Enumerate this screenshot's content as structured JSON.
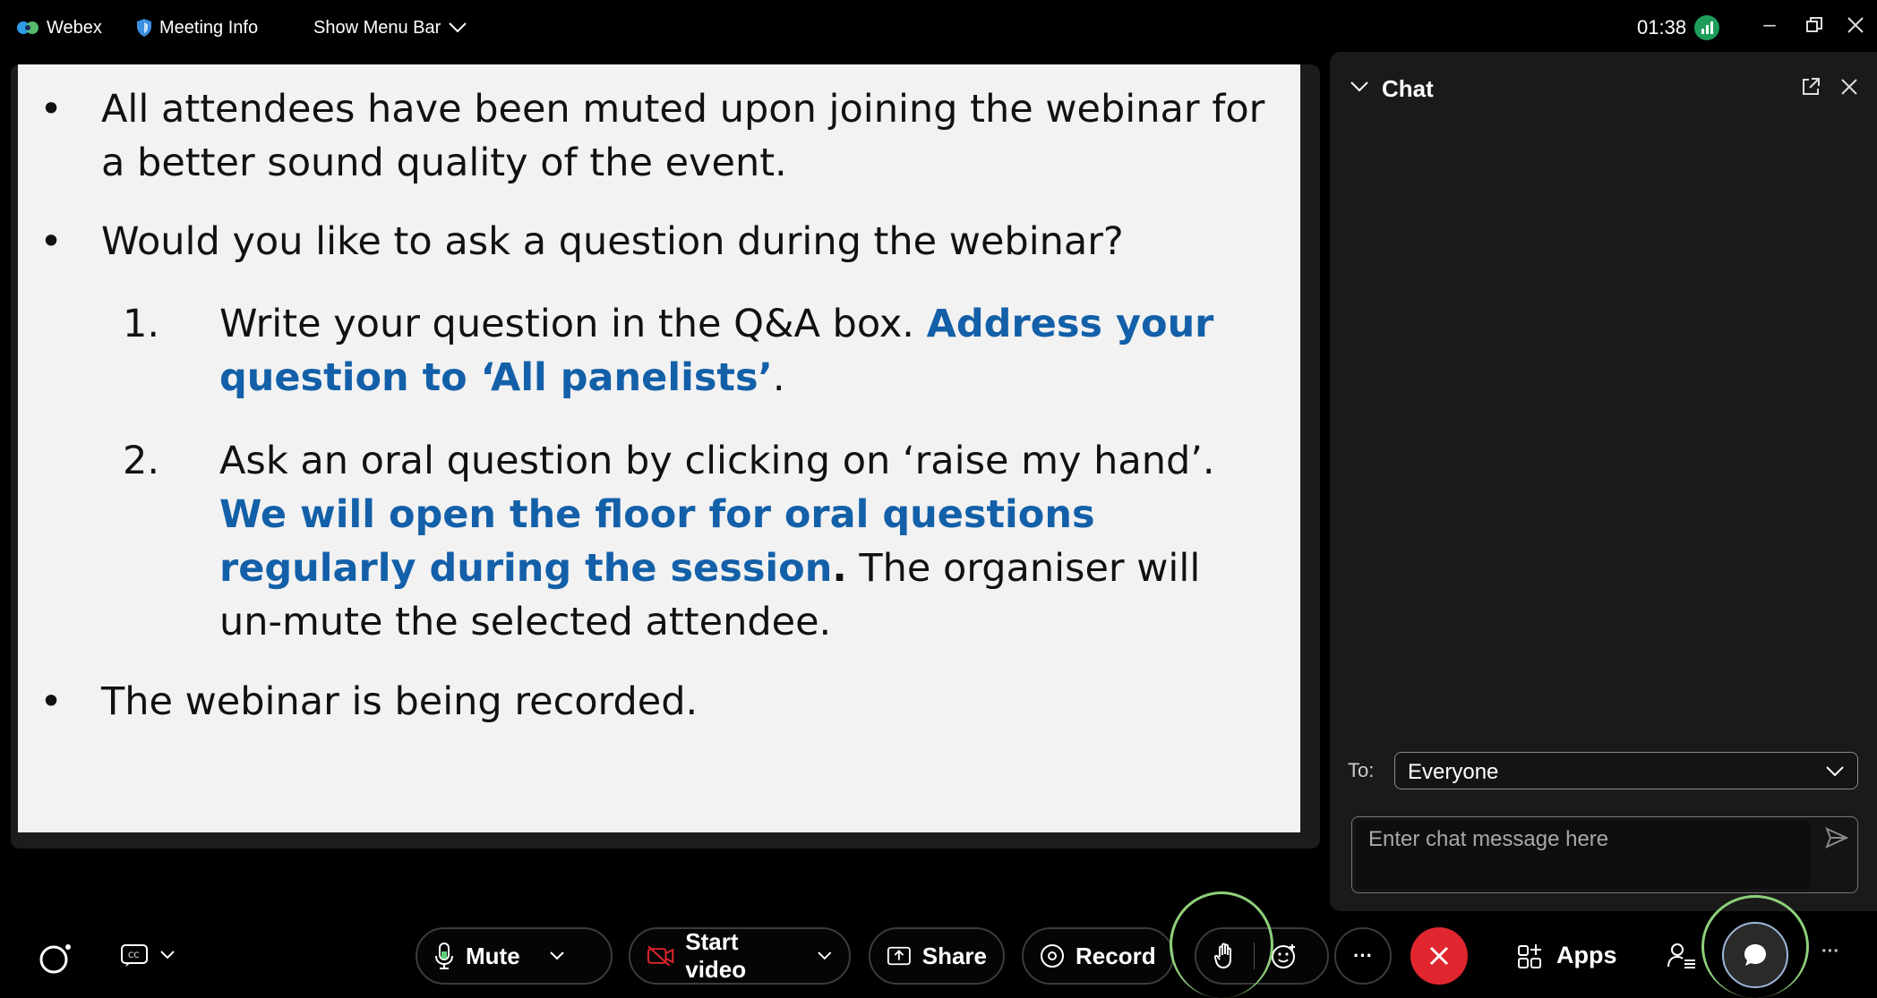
{
  "topbar": {
    "app_name": "Webex",
    "meeting_info": "Meeting Info",
    "show_menu_bar": "Show Menu Bar",
    "time": "01:38"
  },
  "slide": {
    "bullet1": "All attendees have been muted upon joining the webinar for a better sound quality of the event.",
    "bullet2": "Would you like to ask a question during the webinar?",
    "item1_num": "1.",
    "item1_text": "Write your question in the Q&A box.",
    "item1_bold": "Address your question to ‘All panelists’",
    "item1_end": ".",
    "item2_num": "2.",
    "item2_text": "Ask an oral question by clicking on ‘raise my hand’.",
    "item2_bold": "We will open the floor for oral questions regularly during the session",
    "item2_dot": ".",
    "item2_rest": "The organiser will un-mute the selected attendee.",
    "bullet3": "The webinar is being recorded."
  },
  "chat": {
    "title": "Chat",
    "to_label": "To:",
    "to_value": "Everyone",
    "message_placeholder": "Enter chat message here"
  },
  "controls": {
    "mute": "Mute",
    "start_video": "Start video",
    "share": "Share",
    "record": "Record",
    "apps": "Apps",
    "more": "···"
  },
  "colors": {
    "accent_blue": "#1360a9",
    "end_call_red": "#e0262f",
    "highlight_green": "#8ed07a"
  },
  "icons": [
    "webex-logo-icon",
    "shield-icon",
    "chevron-down-icon",
    "network-icon",
    "minimize-icon",
    "restore-icon",
    "close-icon",
    "popout-icon",
    "send-icon",
    "microphone-icon",
    "video-off-icon",
    "share-icon",
    "record-icon",
    "raise-hand-icon",
    "reaction-icon",
    "end-call-icon",
    "apps-icon",
    "participants-icon",
    "chat-bubble-icon",
    "captions-icon",
    "assistant-icon"
  ]
}
